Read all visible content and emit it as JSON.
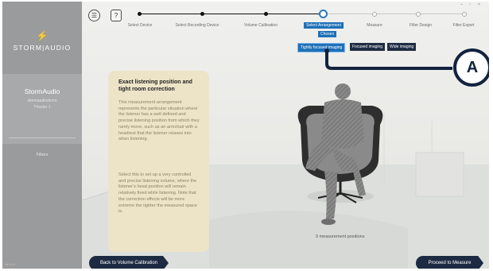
{
  "sidebar": {
    "brand": "STORM|AUDIO",
    "brand_symbol": "⚡",
    "device_name": "StormAudio",
    "device_sub": "stormaudiodemo",
    "theater": "Theater 1",
    "filters_label": "Filters",
    "version": "v4.0.14"
  },
  "toolbar": {
    "menu_icon": "☰",
    "help_label": "?"
  },
  "window_controls": {
    "minimize": "–",
    "maximize": "▫",
    "close": "×"
  },
  "steps": [
    {
      "label": "Select Device",
      "state": "done"
    },
    {
      "label": "Select Recording Device",
      "state": "done"
    },
    {
      "label": "Volume Calibration",
      "state": "done"
    },
    {
      "label": "Select Arrangement",
      "state": "current"
    },
    {
      "label": "Measure",
      "state": "future"
    },
    {
      "label": "Filter Design",
      "state": "future"
    },
    {
      "label": "Filter Export",
      "state": "future"
    }
  ],
  "arrangement_group": "Chosen",
  "options": [
    {
      "label": "Tightly focused imaging",
      "selected": true
    },
    {
      "label": "Focused imaging",
      "selected": false
    },
    {
      "label": "Wide imaging",
      "selected": false
    }
  ],
  "callout_label": "A",
  "info_card": {
    "title": "Exact listening position and tight room correction",
    "paragraph1": "This measurement arrangement represents the particular situation where the listener has a well defined and precise listening position from which they rarely move, such as an armchair with a headrest that the listener relaxes into when listening.",
    "paragraph2": "Select this to set up a very controlled and precise listening volume, where the listener's head position will remain relatively fixed while listening. Note that the correction effects will be more extreme the tighter the measured space is."
  },
  "measurement_positions": "9 measurement positions",
  "nav": {
    "back_label": "Back to Volume Calibration",
    "next_label": "Proceed to Measure"
  },
  "colors": {
    "accent": "#1e70b8",
    "navy": "#1d2b42",
    "sidebar": "#9a9b9c",
    "card": "#ede4c8"
  }
}
